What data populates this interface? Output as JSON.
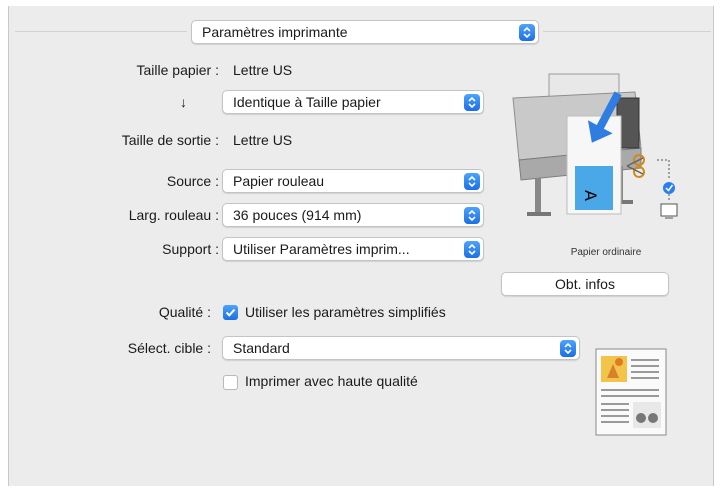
{
  "header": {
    "preset_popup": "Paramètres imprimante"
  },
  "fields": {
    "paper_size_label": "Taille papier :",
    "paper_size_value": "Lettre US",
    "arrow_glyph": "↓",
    "scale_popup": "Identique à Taille papier",
    "output_size_label": "Taille de sortie :",
    "output_size_value": "Lettre US",
    "source_label": "Source :",
    "source_popup": "Papier rouleau",
    "roll_width_label": "Larg. rouleau :",
    "roll_width_popup": "36 pouces (914 mm)",
    "media_label": "Support :",
    "media_popup": "Utiliser Paramètres imprim..."
  },
  "printer_panel": {
    "media_caption": "Papier ordinaire",
    "get_info_button": "Obt. infos"
  },
  "quality": {
    "label": "Qualité :",
    "simple_settings_checked": true,
    "simple_settings_label": "Utiliser les paramètres simplifiés",
    "target_label": "Sélect. cible :",
    "target_popup": "Standard",
    "high_quality_checked": false,
    "high_quality_label": "Imprimer avec haute qualité"
  },
  "colors": {
    "accent": "#2a7ef0",
    "panel": "#ececec"
  }
}
